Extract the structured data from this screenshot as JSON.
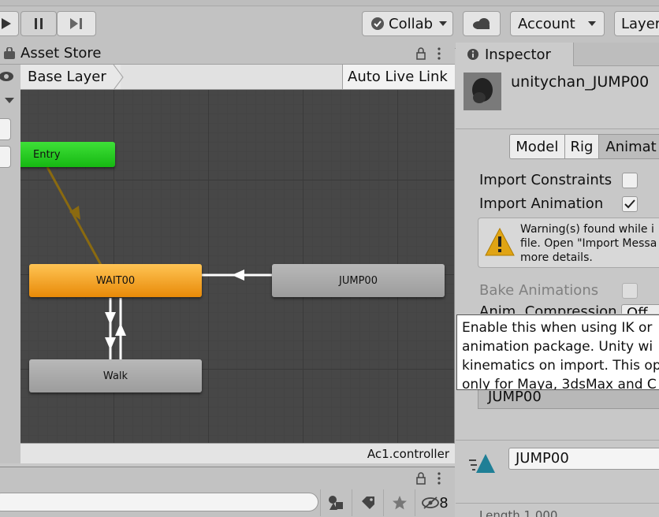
{
  "toolbar": {
    "play_icon": "play-icon",
    "pause_icon": "pause-icon",
    "step_icon": "step-icon",
    "collab_label": "Collab",
    "cloud_icon": "cloud-icon",
    "account_label": "Account",
    "layers_label": "Layer"
  },
  "left_window": {
    "tab_label": "Asset Store",
    "breadcrumb": "Base Layer",
    "auto_live_link": "Auto Live Link",
    "footer_path": "Ac1.controller"
  },
  "graph": {
    "states": [
      {
        "name": "Entry",
        "color": "#22c81e"
      },
      {
        "name": "WAIT00",
        "color": "#f29a15"
      },
      {
        "name": "JUMP00",
        "color": "#a8a8a8"
      },
      {
        "name": "Walk",
        "color": "#a8a8a8"
      }
    ]
  },
  "bottom_panel": {
    "hidden_count": "8"
  },
  "inspector": {
    "tab_label": "Inspector",
    "asset_name": "unitychan_JUMP00",
    "tabs": [
      "Model",
      "Rig",
      "Animat"
    ],
    "import_constraints_label": "Import Constraints",
    "import_constraints_checked": false,
    "import_animation_label": "Import Animation",
    "import_animation_checked": true,
    "warning_lines": [
      "Warning(s) found while i",
      "file. Open \"Import Messa",
      "more details."
    ],
    "bake_animations_label": "Bake Animations",
    "anim_compression_label": "Anim. Compression",
    "anim_compression_value": "Off",
    "clip_field_value": "JUMP00",
    "clip_name_value": "JUMP00",
    "length_text": "Length 1.000"
  },
  "tooltip": {
    "lines": [
      "Enable this when using IK or",
      "animation package. Unity wi",
      "kinematics on import. This op",
      "only for Maya, 3dsMax and C"
    ]
  }
}
